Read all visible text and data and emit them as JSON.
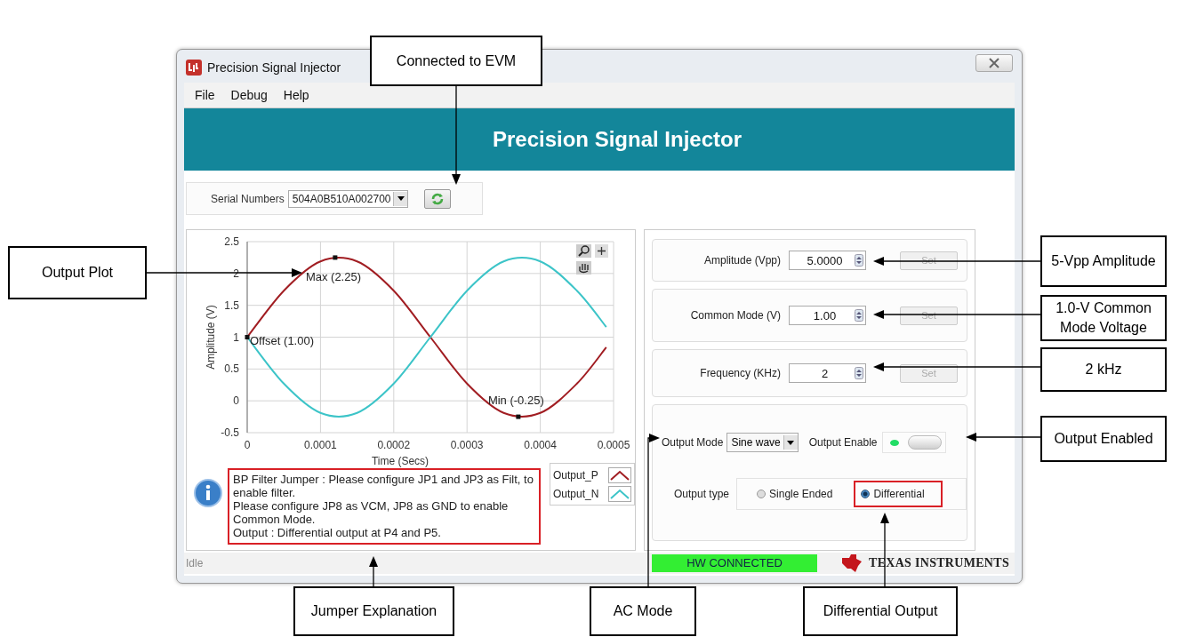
{
  "window": {
    "title": "Precision Signal Injector"
  },
  "menu": [
    {
      "label": "File"
    },
    {
      "label": "Debug"
    },
    {
      "label": "Help"
    }
  ],
  "banner": {
    "title": "Precision Signal Injector"
  },
  "serial": {
    "label": "Serial Numbers",
    "value": "504A0B510A002700"
  },
  "plot": {
    "chart_data": {
      "type": "line",
      "xlabel": "Time (Secs)",
      "ylabel": "Amplitude (V)",
      "x": [
        0,
        5e-05,
        0.0001,
        0.00015,
        0.0002,
        0.00025,
        0.0003,
        0.00035,
        0.0004,
        0.00045,
        0.00049
      ],
      "series": [
        {
          "name": "Output_P",
          "color": "#a11d22",
          "values": [
            1,
            1.73,
            2.19,
            2.19,
            1.73,
            1,
            0.27,
            -0.19,
            -0.19,
            0.27,
            0.84
          ]
        },
        {
          "name": "Output_N",
          "color": "#3cc4c8",
          "values": [
            1,
            0.27,
            -0.19,
            -0.19,
            0.27,
            1,
            1.73,
            2.19,
            2.19,
            1.73,
            1.16
          ]
        }
      ],
      "grid": true,
      "xlim": [
        0,
        0.0005
      ],
      "ylim": [
        -0.5,
        2.5
      ],
      "xticks": [
        0,
        0.0001,
        0.0002,
        0.0003,
        0.0004,
        0.0005
      ],
      "yticks": [
        -0.5,
        0,
        0.5,
        1,
        1.5,
        2,
        2.5
      ],
      "annotations": [
        {
          "x": 0.00012,
          "y": 2.25,
          "text": "Max (2.25)"
        },
        {
          "x": 0,
          "y": 1,
          "text": "Offset (1.00)"
        },
        {
          "x": 0.00037,
          "y": -0.25,
          "text": "Min (-0.25)"
        }
      ]
    }
  },
  "info": {
    "text": "BP Filter Jumper :  Please configure JP1 and JP3 as Filt, to enable filter.\nPlease configure JP8 as VCM, JP8 as GND to enable Common Mode.\nOutput : Differential output at P4 and P5."
  },
  "settings": [
    {
      "label": "Amplitude (Vpp)",
      "value": "5.0000",
      "button": "Set",
      "disabled": true
    },
    {
      "label": "Common Mode (V)",
      "value": "1.00",
      "button": "Set",
      "disabled": true
    },
    {
      "label": "Frequency (KHz)",
      "value": "2",
      "button": "Set",
      "disabled": true
    }
  ],
  "output_mode": {
    "label": "Output Mode",
    "value": "Sine wave"
  },
  "output_enable": {
    "label": "Output Enable",
    "on": true
  },
  "output_type": {
    "label": "Output type",
    "options": [
      {
        "label": "Single Ended",
        "selected": false,
        "highlighted": false
      },
      {
        "label": "Differential",
        "selected": true,
        "highlighted": true
      }
    ]
  },
  "status_bar": {
    "text": "Idle",
    "connection": "HW CONNECTED",
    "connected": true,
    "logo": "TEXAS INSTRUMENTS"
  },
  "callouts": [
    {
      "text": "Connected to EVM"
    },
    {
      "text": "Output Plot"
    },
    {
      "text": "5-Vpp Amplitude"
    },
    {
      "text": "1.0-V Common Mode Voltage"
    },
    {
      "text": "2 kHz"
    },
    {
      "text": "Output Enabled"
    },
    {
      "text": "Jumper Explanation"
    },
    {
      "text": "AC Mode"
    },
    {
      "text": "Differential Output"
    }
  ]
}
